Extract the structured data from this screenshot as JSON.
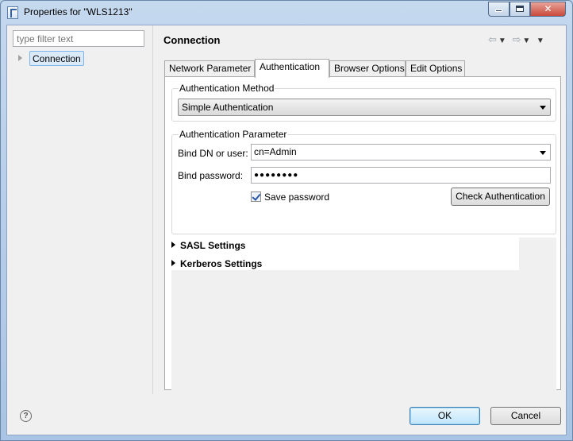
{
  "window": {
    "title": "Properties for \"WLS1213\"",
    "close_glyph": "✕"
  },
  "left": {
    "filter_placeholder": "type filter text",
    "tree_items": [
      {
        "label": "Connection",
        "selected": true,
        "expandable": true
      }
    ]
  },
  "page": {
    "title": "Connection"
  },
  "tabs": [
    {
      "label": "Network Parameter",
      "active": false
    },
    {
      "label": "Authentication",
      "active": true
    },
    {
      "label": "Browser Options",
      "active": false
    },
    {
      "label": "Edit Options",
      "active": false
    }
  ],
  "auth_method": {
    "legend": "Authentication Method",
    "selected": "Simple Authentication"
  },
  "auth_param": {
    "legend": "Authentication Parameter",
    "bind_dn_label": "Bind DN or user:",
    "bind_dn_value": "cn=Admin",
    "bind_password_label": "Bind password:",
    "bind_password_value": "●●●●●●●●",
    "save_password_label": "Save password",
    "save_password_checked": true,
    "check_button": "Check Authentication"
  },
  "sections": [
    {
      "label": "SASL Settings"
    },
    {
      "label": "Kerberos Settings"
    }
  ],
  "footer": {
    "help_glyph": "?",
    "ok": "OK",
    "cancel": "Cancel"
  }
}
